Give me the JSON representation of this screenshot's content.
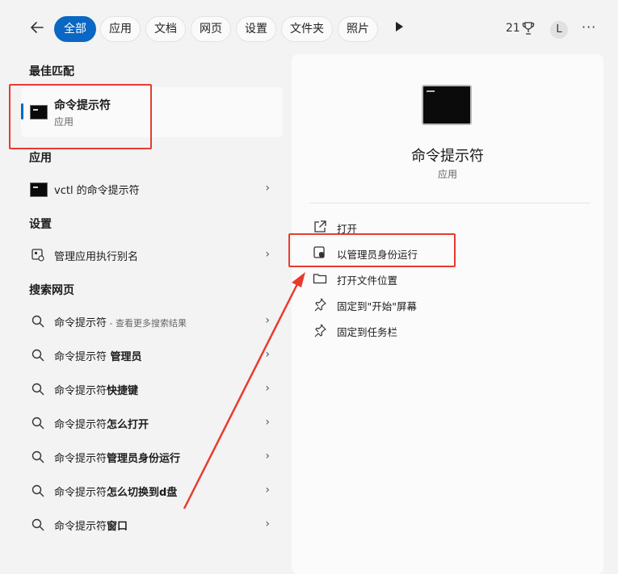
{
  "tabs": [
    "全部",
    "应用",
    "文档",
    "网页",
    "设置",
    "文件夹",
    "照片"
  ],
  "header": {
    "points": "21",
    "avatar_letter": "L",
    "more": "···"
  },
  "left": {
    "best_match_heading": "最佳匹配",
    "best_match": {
      "name": "命令提示符",
      "type": "应用"
    },
    "apps_heading": "应用",
    "apps": [
      {
        "label": "vctl 的命令提示符"
      }
    ],
    "settings_heading": "设置",
    "settings": [
      {
        "label": "管理应用执行别名"
      }
    ],
    "web_heading": "搜索网页",
    "web_first": {
      "label": "命令提示符",
      "hint": " - 查看更多搜索结果"
    },
    "web": [
      {
        "prefix": "命令提示符",
        "bold": " 管理员"
      },
      {
        "prefix": "命令提示符",
        "bold": "快捷键"
      },
      {
        "prefix": "命令提示符",
        "bold": "怎么打开"
      },
      {
        "prefix": "命令提示符",
        "bold": "管理员身份运行"
      },
      {
        "prefix": "命令提示符",
        "bold": "怎么切换到d盘"
      },
      {
        "prefix": "命令提示符",
        "bold": "窗口"
      }
    ]
  },
  "right": {
    "title": "命令提示符",
    "subtitle": "应用",
    "actions": [
      {
        "label": "打开",
        "icon": "open-external-icon"
      },
      {
        "label": "以管理员身份运行",
        "icon": "shield-admin-icon"
      },
      {
        "label": "打开文件位置",
        "icon": "folder-icon"
      },
      {
        "label": "固定到\"开始\"屏幕",
        "icon": "pin-icon"
      },
      {
        "label": "固定到任务栏",
        "icon": "pin-icon"
      }
    ]
  },
  "annotation_color": "#e83b2f",
  "accent_color": "#0a67c4"
}
